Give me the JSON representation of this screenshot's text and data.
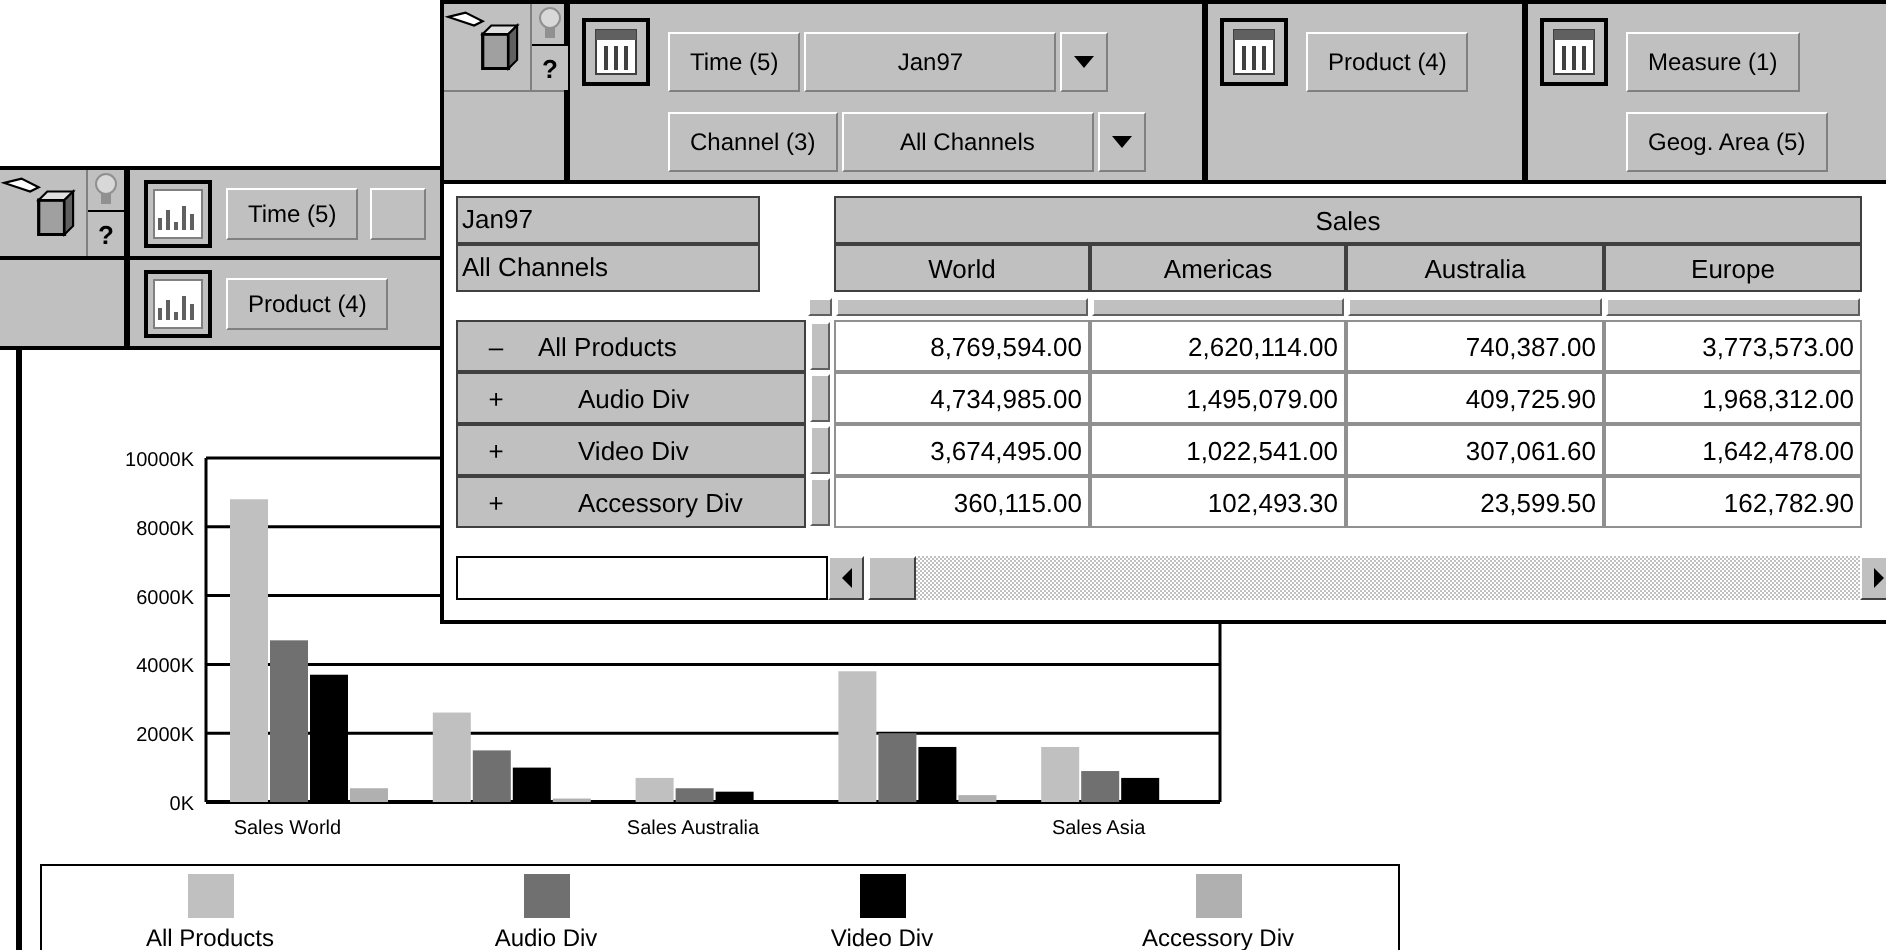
{
  "back_window": {
    "help_label": "?",
    "toolbar_rows": [
      {
        "label": "Time (5)",
        "selector": true
      },
      {
        "label": "Product (4)",
        "selector": false
      }
    ],
    "chart_data": {
      "type": "bar",
      "stacked": false,
      "grid": true,
      "legend": "bottom",
      "categories": [
        "Sales World",
        null,
        "Sales Australia",
        null,
        "Sales Asia"
      ],
      "ylim": [
        0,
        10000
      ],
      "yticks": [
        {
          "value": 0,
          "label": "0K"
        },
        {
          "value": 2000,
          "label": "2000K"
        },
        {
          "value": 4000,
          "label": "4000K"
        },
        {
          "value": 6000,
          "label": "6000K"
        },
        {
          "value": 8000,
          "label": "8000K"
        },
        {
          "value": 10000,
          "label": "10000K"
        }
      ],
      "series": [
        {
          "name": "All Products",
          "color": "#c0c0c0",
          "values": [
            8800,
            2600,
            700,
            3800,
            1600
          ]
        },
        {
          "name": "Audio Div",
          "color": "#707070",
          "values": [
            4700,
            1500,
            400,
            2000,
            900
          ]
        },
        {
          "name": "Video Div",
          "color": "#000000",
          "values": [
            3700,
            1000,
            300,
            1600,
            700
          ]
        },
        {
          "name": "Accessory Div",
          "color": "#b0b0b0",
          "values": [
            400,
            100,
            0,
            200,
            0
          ]
        }
      ]
    }
  },
  "front_window": {
    "help_label": "?",
    "toolbar_groups": [
      {
        "rows": [
          {
            "label": "Time (5)",
            "value": "Jan97"
          },
          {
            "label": "Channel (3)",
            "value": "All Channels"
          }
        ]
      },
      {
        "rows": [
          {
            "label": "Product (4)"
          }
        ]
      },
      {
        "rows": [
          {
            "label": "Measure (1)"
          },
          {
            "label": "Geog. Area (5)"
          }
        ]
      }
    ],
    "page_items": [
      "Jan97",
      "All Channels"
    ],
    "table": {
      "measure": "Sales",
      "columns": [
        "World",
        "Americas",
        "Australia",
        "Europe"
      ],
      "rows": [
        {
          "toggle": "–",
          "label": "All Products",
          "values": [
            "8,769,594.00",
            "2,620,114.00",
            "740,387.00",
            "3,773,573.00"
          ],
          "children": [
            {
              "toggle": "+",
              "label": "Audio Div",
              "values": [
                "4,734,985.00",
                "1,495,079.00",
                "409,725.90",
                "1,968,312.00"
              ]
            },
            {
              "toggle": "+",
              "label": "Video Div",
              "values": [
                "3,674,495.00",
                "1,022,541.00",
                "307,061.60",
                "1,642,478.00"
              ]
            },
            {
              "toggle": "+",
              "label": "Accessory Div",
              "values": [
                "360,115.00",
                "102,493.30",
                "23,599.50",
                "162,782.90"
              ]
            }
          ]
        }
      ]
    }
  }
}
